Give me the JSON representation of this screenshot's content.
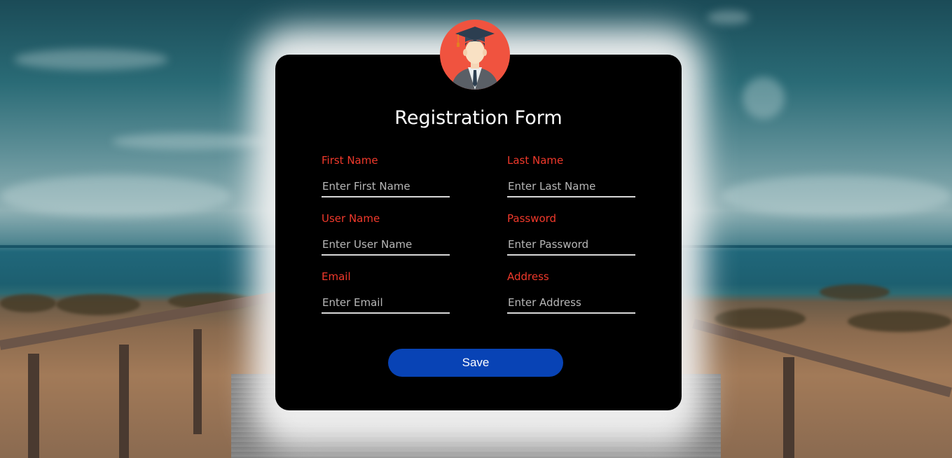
{
  "form": {
    "title": "Registration Form",
    "fields": [
      {
        "label": "First Name",
        "placeholder": "Enter First Name",
        "value": ""
      },
      {
        "label": "Last Name",
        "placeholder": "Enter Last Name",
        "value": ""
      },
      {
        "label": "User Name",
        "placeholder": "Enter User Name",
        "value": ""
      },
      {
        "label": "Password",
        "placeholder": "Enter Password",
        "value": ""
      },
      {
        "label": "Email",
        "placeholder": "Enter Email",
        "value": ""
      },
      {
        "label": "Address",
        "placeholder": "Enter Address",
        "value": ""
      }
    ],
    "save_label": "Save"
  },
  "avatar": {
    "icon": "graduate-avatar-icon"
  },
  "colors": {
    "label": "#f0392b",
    "button": "#0843b5",
    "card": "#000000",
    "avatar_bg": "#f0533f"
  }
}
